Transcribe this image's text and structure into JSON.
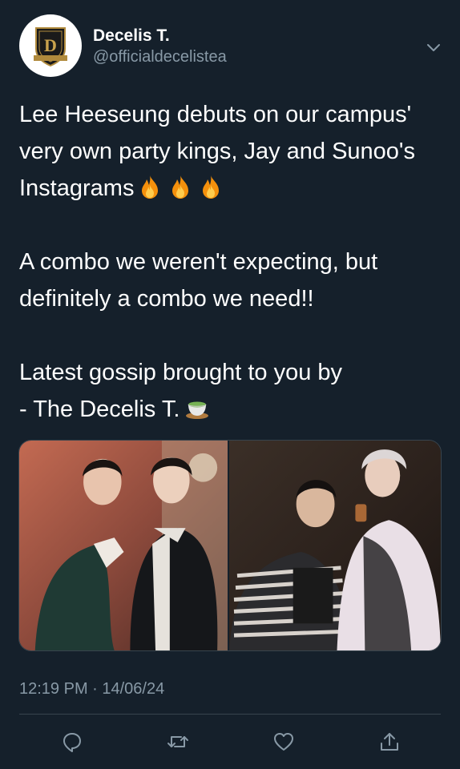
{
  "tweet": {
    "author": {
      "display_name": "Decelis T.",
      "handle": "@officialdecelistea",
      "avatar_icon": "decelis-crest-logo"
    },
    "body": {
      "paragraph_1": "Lee Heeseung debuts on our campus' very own party kings, Jay and Sunoo's Instagrams",
      "paragraph_1_emoji": [
        "fire-emoji",
        "fire-emoji",
        "fire-emoji"
      ],
      "paragraph_2": "A combo we weren't expecting, but definitely a combo we need!!",
      "paragraph_3_line_1": "Latest gossip brought to you by",
      "paragraph_3_line_2": "- The Decelis T.",
      "paragraph_3_emoji": "tea-emoji"
    },
    "media": {
      "photos": [
        "photo-left",
        "photo-right"
      ]
    },
    "timestamp": "12:19 PM · 14/06/24",
    "actions": [
      "reply-icon",
      "retweet-icon",
      "like-icon",
      "share-icon"
    ]
  },
  "colors": {
    "background": "#15202b",
    "text_primary": "#ffffff",
    "text_secondary": "#8899a6",
    "divider": "#38444d"
  }
}
